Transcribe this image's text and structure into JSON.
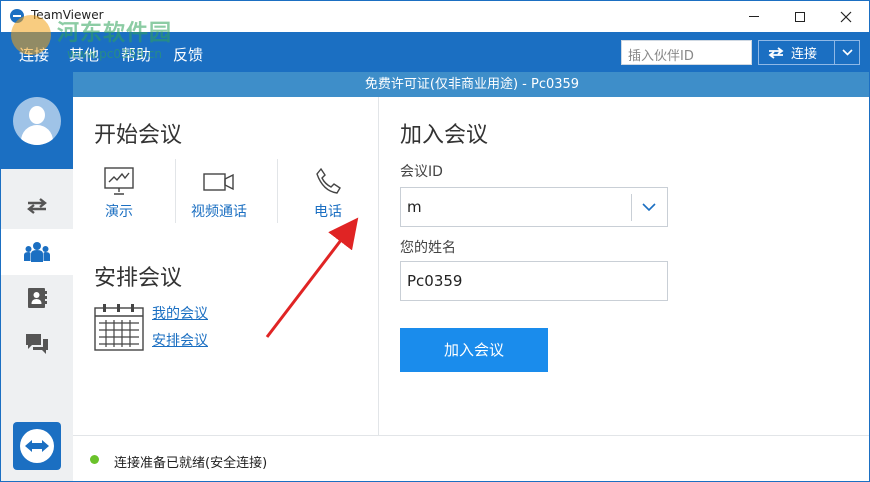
{
  "titlebar": {
    "title": "TeamViewer"
  },
  "watermark": {
    "text": "河东软件园",
    "url": "www.pc0359.cn"
  },
  "menu": {
    "items": [
      {
        "label": "连接"
      },
      {
        "label": "其他"
      },
      {
        "label": "帮助"
      },
      {
        "label": "反馈"
      }
    ],
    "partner_placeholder": "插入伙伴ID",
    "connect_label": "连接"
  },
  "license_text": "免费许可证(仅非商业用途) - Pc0359",
  "sidebar": {
    "items": [
      {
        "icon": "arrows-icon"
      },
      {
        "icon": "meeting-people-icon",
        "active": true
      },
      {
        "icon": "contacts-icon"
      },
      {
        "icon": "chat-icon"
      }
    ]
  },
  "start_meeting": {
    "title": "开始会议",
    "options": [
      {
        "label": "演示",
        "icon": "presentation-icon"
      },
      {
        "label": "视频通话",
        "icon": "video-camera-icon"
      },
      {
        "label": "电话",
        "icon": "phone-icon"
      }
    ]
  },
  "schedule": {
    "title": "安排会议",
    "links": [
      {
        "label": "我的会议"
      },
      {
        "label": "安排会议"
      }
    ]
  },
  "join_meeting": {
    "title": "加入会议",
    "meeting_id_label": "会议ID",
    "meeting_id_value": "m",
    "name_label": "您的姓名",
    "name_value": "Pc0359",
    "button": "加入会议"
  },
  "status": {
    "text": "连接准备已就绪(安全连接)",
    "color": "#6ac22a"
  },
  "colors": {
    "primary": "#1b6fc2",
    "license_bar": "#3e8ec9",
    "join_button": "#1a8cec",
    "annotation": "#e02424"
  }
}
